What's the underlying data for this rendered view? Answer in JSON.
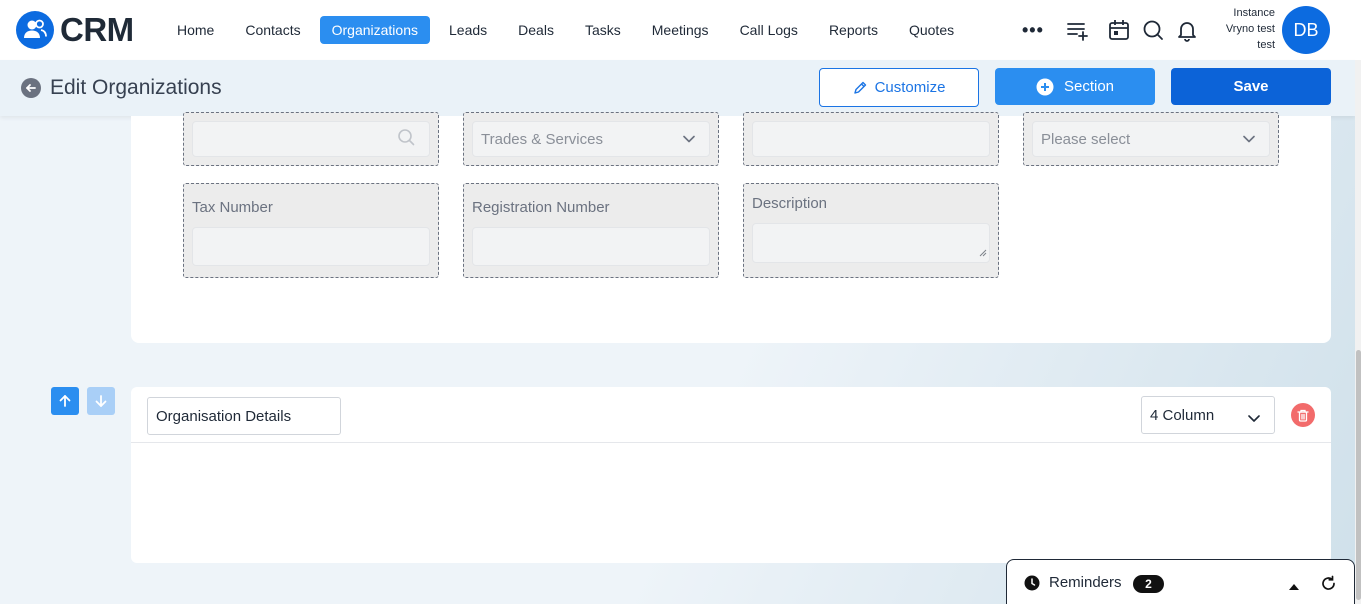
{
  "app": {
    "logo_text": "CRM"
  },
  "nav": {
    "items": [
      {
        "label": "Home"
      },
      {
        "label": "Contacts"
      },
      {
        "label": "Organizations",
        "active": true
      },
      {
        "label": "Leads"
      },
      {
        "label": "Deals"
      },
      {
        "label": "Tasks"
      },
      {
        "label": "Meetings"
      },
      {
        "label": "Call Logs"
      },
      {
        "label": "Reports"
      },
      {
        "label": "Quotes"
      }
    ],
    "more_icon": "more-dots-icon",
    "icons": [
      "quick-create-icon",
      "calendar-icon",
      "search-icon",
      "bell-icon"
    ]
  },
  "user": {
    "instance_line1": "Instance",
    "instance_line2": "Vryno test",
    "instance_line3": "test",
    "avatar_initials": "DB"
  },
  "header": {
    "title": "Edit Organizations",
    "customize_label": "Customize",
    "section_label": "Section",
    "save_label": "Save"
  },
  "section1": {
    "top_fields": [
      {
        "value": "",
        "icon": "search-icon"
      },
      {
        "value": "Trades & Services",
        "icon": "chevron-down-icon"
      },
      {
        "value": ""
      },
      {
        "value": "Please select",
        "icon": "chevron-down-icon"
      }
    ],
    "fields": [
      {
        "label": "Tax Number"
      },
      {
        "label": "Registration Number"
      },
      {
        "label": "Description"
      }
    ]
  },
  "section2": {
    "name_value": "Organisation Details",
    "columns_value": "4 Column"
  },
  "reminders": {
    "label": "Reminders",
    "count": "2"
  },
  "colors": {
    "primary": "#0c63d8",
    "accent": "#2b8ef0",
    "danger": "#f26b6b"
  }
}
